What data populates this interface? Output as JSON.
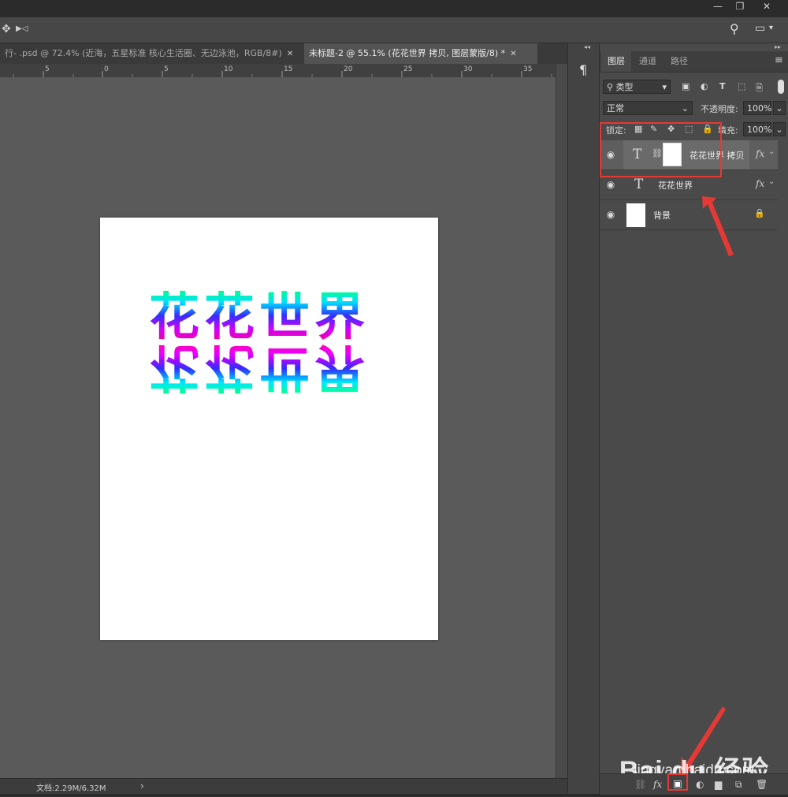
{
  "window": {
    "minimize": "—",
    "restore": "❐",
    "close": "✕"
  },
  "options_bar": {
    "move_icon": "✥",
    "video_icon": "▶◁",
    "search_icon": "⚲",
    "workspace_icon": "▭"
  },
  "tabs": [
    {
      "label": "行- .psd @ 72.4% (近海，五星标准 核心生活圈、无边泳池，RGB/8#)",
      "close": "✕"
    },
    {
      "label": "未标题-2 @ 55.1% (花花世界 拷贝, 图层蒙版/8) *",
      "close": "✕"
    }
  ],
  "ruler": {
    "numbers": [
      "5",
      "0",
      "5",
      "10",
      "15",
      "20",
      "25",
      "30",
      "35"
    ]
  },
  "canvas": {
    "art_text": "花花世界",
    "reflection_text": "花花世界"
  },
  "status": {
    "doc_info": "文档:2.29M/6.32M",
    "arrow": "›"
  },
  "collapse": {
    "top_arrows": "◂◂",
    "panel_arrows": "▸▸",
    "tool_icon": "¶"
  },
  "panel": {
    "tabs": [
      "图层",
      "通道",
      "路径"
    ],
    "menu_icon": "≡",
    "filter": {
      "search_icon": "⚲",
      "kind": "类型",
      "dropdown": "▾",
      "icons": [
        "▣",
        "◐",
        "T",
        "⬚",
        "🗎"
      ]
    },
    "blend": {
      "mode": "正常",
      "opacity_label": "不透明度:",
      "opacity": "100%"
    },
    "lock": {
      "label": "锁定:",
      "icons": [
        "▦",
        "✎",
        "✥",
        "⬚",
        "🔒"
      ],
      "fill_label": "填充:",
      "fill": "100%"
    },
    "layers": [
      {
        "name": "花花世界 拷贝",
        "type_glyph": "T",
        "link": "⛓",
        "fx": "fx",
        "chevron": "⌄",
        "eye": "◉"
      },
      {
        "name": "花花世界",
        "type_glyph": "T",
        "fx": "fx",
        "chevron": "⌄",
        "eye": "◉"
      },
      {
        "name": "背景",
        "lock": "🔒",
        "eye": "◉"
      }
    ],
    "bottom_icons": [
      "⛓",
      "fx",
      "▣",
      "◐",
      "▆",
      "⧉",
      "🗑"
    ]
  },
  "watermark": {
    "brand": "Bai du 经验",
    "url": "jingyan.baidu.com"
  },
  "colors": {
    "annotation": "#e53935",
    "panel_bg": "#4a4a4a",
    "canvas_bg": "#5a5a5a"
  }
}
